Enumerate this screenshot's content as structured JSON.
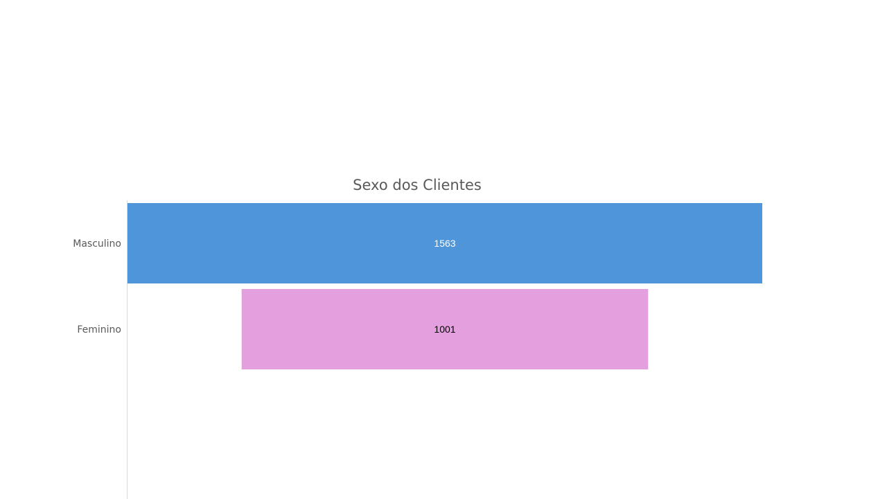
{
  "chart_data": {
    "type": "funnel",
    "title": "Sexo dos Clientes",
    "categories": [
      "Masculino",
      "Feminino"
    ],
    "values": [
      1563,
      1001
    ],
    "colors": [
      "#4F95D9",
      "#E39FDE"
    ],
    "label_colors": [
      "#FFFFFF",
      "#000000"
    ],
    "axis_line_color": "#D9D9D9",
    "grid": false,
    "legend": "none"
  }
}
